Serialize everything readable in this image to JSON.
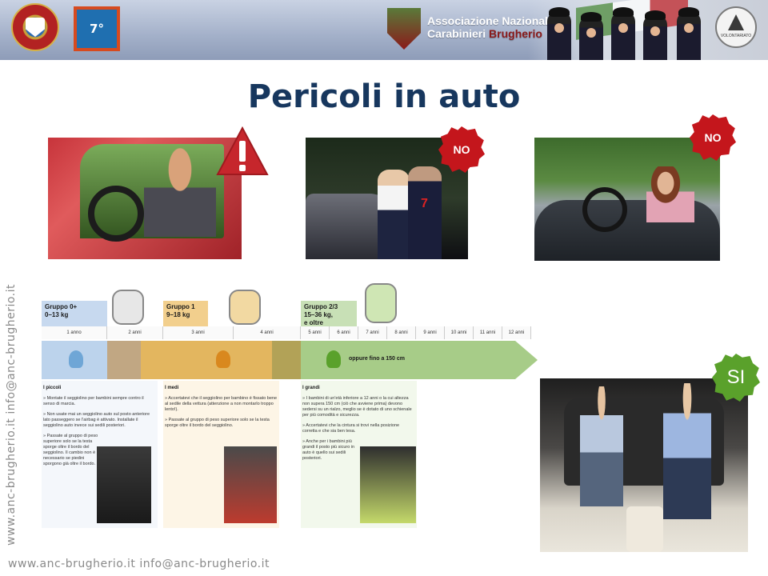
{
  "header": {
    "assoc_line1": "Associazione Nazionale",
    "assoc_line2_a": "Carabinieri ",
    "assoc_line2_b": "Brugherio",
    "square_logo_text": "7°",
    "volontariato_text": "VOLONTARIATO"
  },
  "slide": {
    "title": "Pericoli in auto"
  },
  "badges": {
    "no_1": "NO",
    "no_2": "NO",
    "si": "SI"
  },
  "photos": {
    "cop_jersey_number": "7"
  },
  "infographic": {
    "groups": [
      {
        "title": "Gruppo 0+",
        "weight": "0–13 kg"
      },
      {
        "title": "Gruppo 1",
        "weight": "9–18 kg"
      },
      {
        "title": "Gruppo 2/3",
        "weight": "15–36 kg,",
        "extra": "e oltre"
      }
    ],
    "ages": [
      "1 anno",
      "2 anni",
      "3 anni",
      "4 anni",
      "5 anni",
      "6 anni",
      "7 anni",
      "8 anni",
      "9 anni",
      "10 anni",
      "11 anni",
      "12 anni"
    ],
    "arrow_label": "oppure fino a   150 cm",
    "columns": [
      {
        "heading": "I piccoli",
        "items": [
          "» Montate il seggiolino per bambini sempre contro il senso di marcia.",
          "» Non usate mai un seggiolino auto sul posto anteriore lato passeggero se l'airbag è attivato. Installate il seggiolino auto invece sui sedili posteriori.",
          "» Passate al gruppo di peso superiore solo se la testa sporge oltre il bordo del seggiolino. Il cambio non è necessario se piedini sporgono già oltre il bordo."
        ]
      },
      {
        "heading": "I medi",
        "items": [
          "» Accertatevi che il seggiolino per bambino è fissato bene al sedile della vettura (attenzione a non montarlo troppo lento!).",
          "» Passate al gruppo di peso superiore solo se la testa sporge oltre il bordo del seggiolino."
        ]
      },
      {
        "heading": "I grandi",
        "items": [
          "» I bambini di un'età inferiore a 12 anni o la cui altezza non supera 150 cm (ciò che avviene prima) devono sedersi su un rialzo, meglio se è dotato di uno schienale per più comodità e sicurezza.",
          "» Accertatevi che la cintura si trovi nella posizione corretta e che sia ben tesa.",
          "» Anche per i bambini più grandi il posto più sicuro in auto è quello sui sedili posteriori."
        ]
      }
    ]
  },
  "watermark": {
    "bottom": "www.anc-brugherio.it   info@anc-brugherio.it",
    "side": "www.anc-brugherio.it   info@anc-brugherio.it"
  },
  "icons": {
    "warning": "warning-triangle-icon",
    "badge_no": "no-starburst-icon",
    "badge_si": "si-starburst-icon"
  },
  "colors": {
    "title": "#17375e",
    "no_badge": "#c4161c",
    "si_badge": "#5aa12b",
    "warning": "#c6262c"
  }
}
